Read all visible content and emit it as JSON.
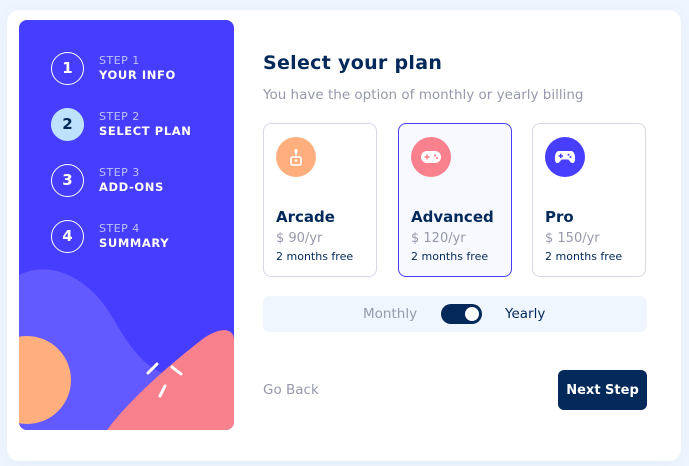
{
  "steps": [
    {
      "number": "1",
      "label": "STEP 1",
      "title": "YOUR INFO",
      "active": false
    },
    {
      "number": "2",
      "label": "STEP 2",
      "title": "SELECT PLAN",
      "active": true
    },
    {
      "number": "3",
      "label": "STEP 3",
      "title": "ADD-ONS",
      "active": false
    },
    {
      "number": "4",
      "label": "STEP 4",
      "title": "SUMMARY",
      "active": false
    }
  ],
  "header": {
    "title": "Select your plan",
    "subtitle": "You have the option of monthly or yearly billing"
  },
  "plans": [
    {
      "name": "Arcade",
      "price": "$ 90/yr",
      "promo": "2 months free",
      "icon": "arcade-icon",
      "color": "#ffaf7e",
      "selected": false
    },
    {
      "name": "Advanced",
      "price": "$ 120/yr",
      "promo": "2 months free",
      "icon": "advanced-icon",
      "color": "#f9818e",
      "selected": true
    },
    {
      "name": "Pro",
      "price": "$ 150/yr",
      "promo": "2 months free",
      "icon": "pro-icon",
      "color": "#483eff",
      "selected": false
    }
  ],
  "billing": {
    "monthly_label": "Monthly",
    "yearly_label": "Yearly",
    "selected": "yearly"
  },
  "footer": {
    "back_label": "Go Back",
    "next_label": "Next Step"
  },
  "colors": {
    "sidebar": "#473dff",
    "primary": "#02295a",
    "active_step": "#bee2fd",
    "muted": "#9699ab"
  }
}
